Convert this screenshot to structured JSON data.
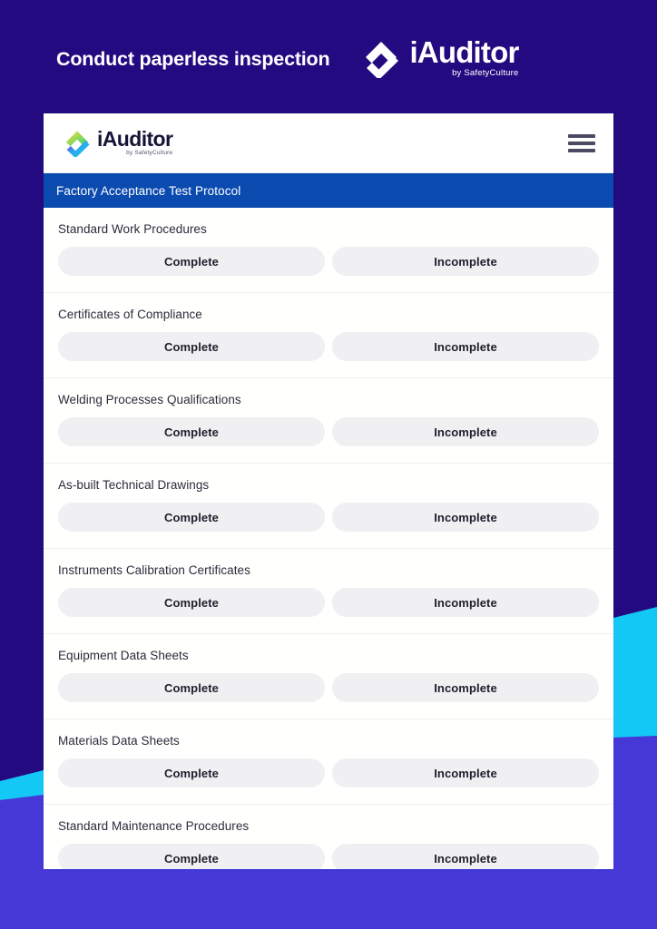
{
  "promo": {
    "headline": "Conduct paperless inspection",
    "logo": {
      "name": "iAuditor",
      "tagline": "by SafetyCulture",
      "mark_icon": "iauditor-diamond-check-icon"
    }
  },
  "app": {
    "logo": {
      "name": "iAuditor",
      "tagline": "by SafetyCulture",
      "mark_icon": "iauditor-diamond-check-icon"
    },
    "menu_icon": "hamburger-menu-icon",
    "protocol_title": "Factory Acceptance Test Protocol",
    "choices": {
      "complete": "Complete",
      "incomplete": "Incomplete"
    },
    "items": [
      {
        "label": "Standard Work Procedures"
      },
      {
        "label": "Certificates of Compliance"
      },
      {
        "label": "Welding Processes Qualifications"
      },
      {
        "label": "As-built Technical Drawings"
      },
      {
        "label": "Instruments Calibration Certificates"
      },
      {
        "label": "Equipment Data Sheets"
      },
      {
        "label": "Materials Data Sheets"
      },
      {
        "label": "Standard Maintenance Procedures"
      }
    ]
  },
  "colors": {
    "background_dark": "#240a80",
    "background_violet": "#4538d6",
    "accent_cyan": "#14c8f5",
    "protocol_bar": "#0b4bb0",
    "card": "#ffffff",
    "button": "#f0f0f2"
  }
}
